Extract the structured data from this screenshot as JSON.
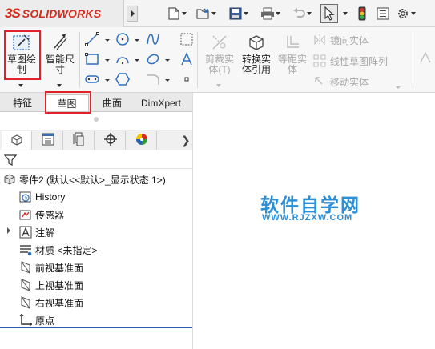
{
  "app": {
    "logo_mark": "3S",
    "logo_text": "SOLIDWORKS"
  },
  "quick_access": [
    {
      "name": "new-document",
      "icon": "new-document-icon"
    },
    {
      "name": "open",
      "icon": "open-folder-icon"
    },
    {
      "name": "save",
      "icon": "save-icon"
    },
    {
      "name": "print",
      "icon": "print-icon"
    },
    {
      "name": "undo",
      "icon": "undo-icon"
    },
    {
      "name": "select",
      "icon": "cursor-icon"
    },
    {
      "name": "rebuild",
      "icon": "traffic-light-icon"
    },
    {
      "name": "file-properties",
      "icon": "properties-icon"
    },
    {
      "name": "options",
      "icon": "gear-icon"
    }
  ],
  "ribbon": {
    "sketch_label": "草图绘\n制",
    "smart_dim_label": "智能尺\n寸",
    "trim_label": "剪裁实\n体(T)",
    "convert_label": "转换实\n体引用",
    "offset_label": "等距实\n体",
    "mirror_label": "镜向实体",
    "linear_pattern_label": "线性草图阵列",
    "move_label": "移动实体"
  },
  "command_tabs": [
    {
      "label": "特征"
    },
    {
      "label": "草图",
      "active": true
    },
    {
      "label": "曲面"
    },
    {
      "label": "DimXpert"
    }
  ],
  "feature_manager": {
    "tab_icons": [
      "feature-tree-icon",
      "property-manager-icon",
      "configuration-icon",
      "dimxpert-icon",
      "appearance-icon"
    ],
    "filter_icon": "filter-icon",
    "part_label": "零件2  (默认<<默认>_显示状态 1>)",
    "items": [
      {
        "label": "History",
        "icon": "history-icon"
      },
      {
        "label": "传感器",
        "icon": "sensor-icon"
      },
      {
        "label": "注解",
        "icon": "annotation-icon",
        "expandable": true
      },
      {
        "label": "材质 <未指定>",
        "icon": "material-icon"
      },
      {
        "label": "前视基准面",
        "icon": "plane-icon"
      },
      {
        "label": "上视基准面",
        "icon": "plane-icon"
      },
      {
        "label": "右视基准面",
        "icon": "plane-icon"
      },
      {
        "label": "原点",
        "icon": "origin-icon"
      }
    ]
  },
  "watermark": {
    "main": "软件自学网",
    "sub": "WWW.RJZXW.COM"
  },
  "colors": {
    "brand_red": "#d52b1e",
    "highlight_red": "#e0232b",
    "watermark_blue": "#2b8fd8"
  }
}
